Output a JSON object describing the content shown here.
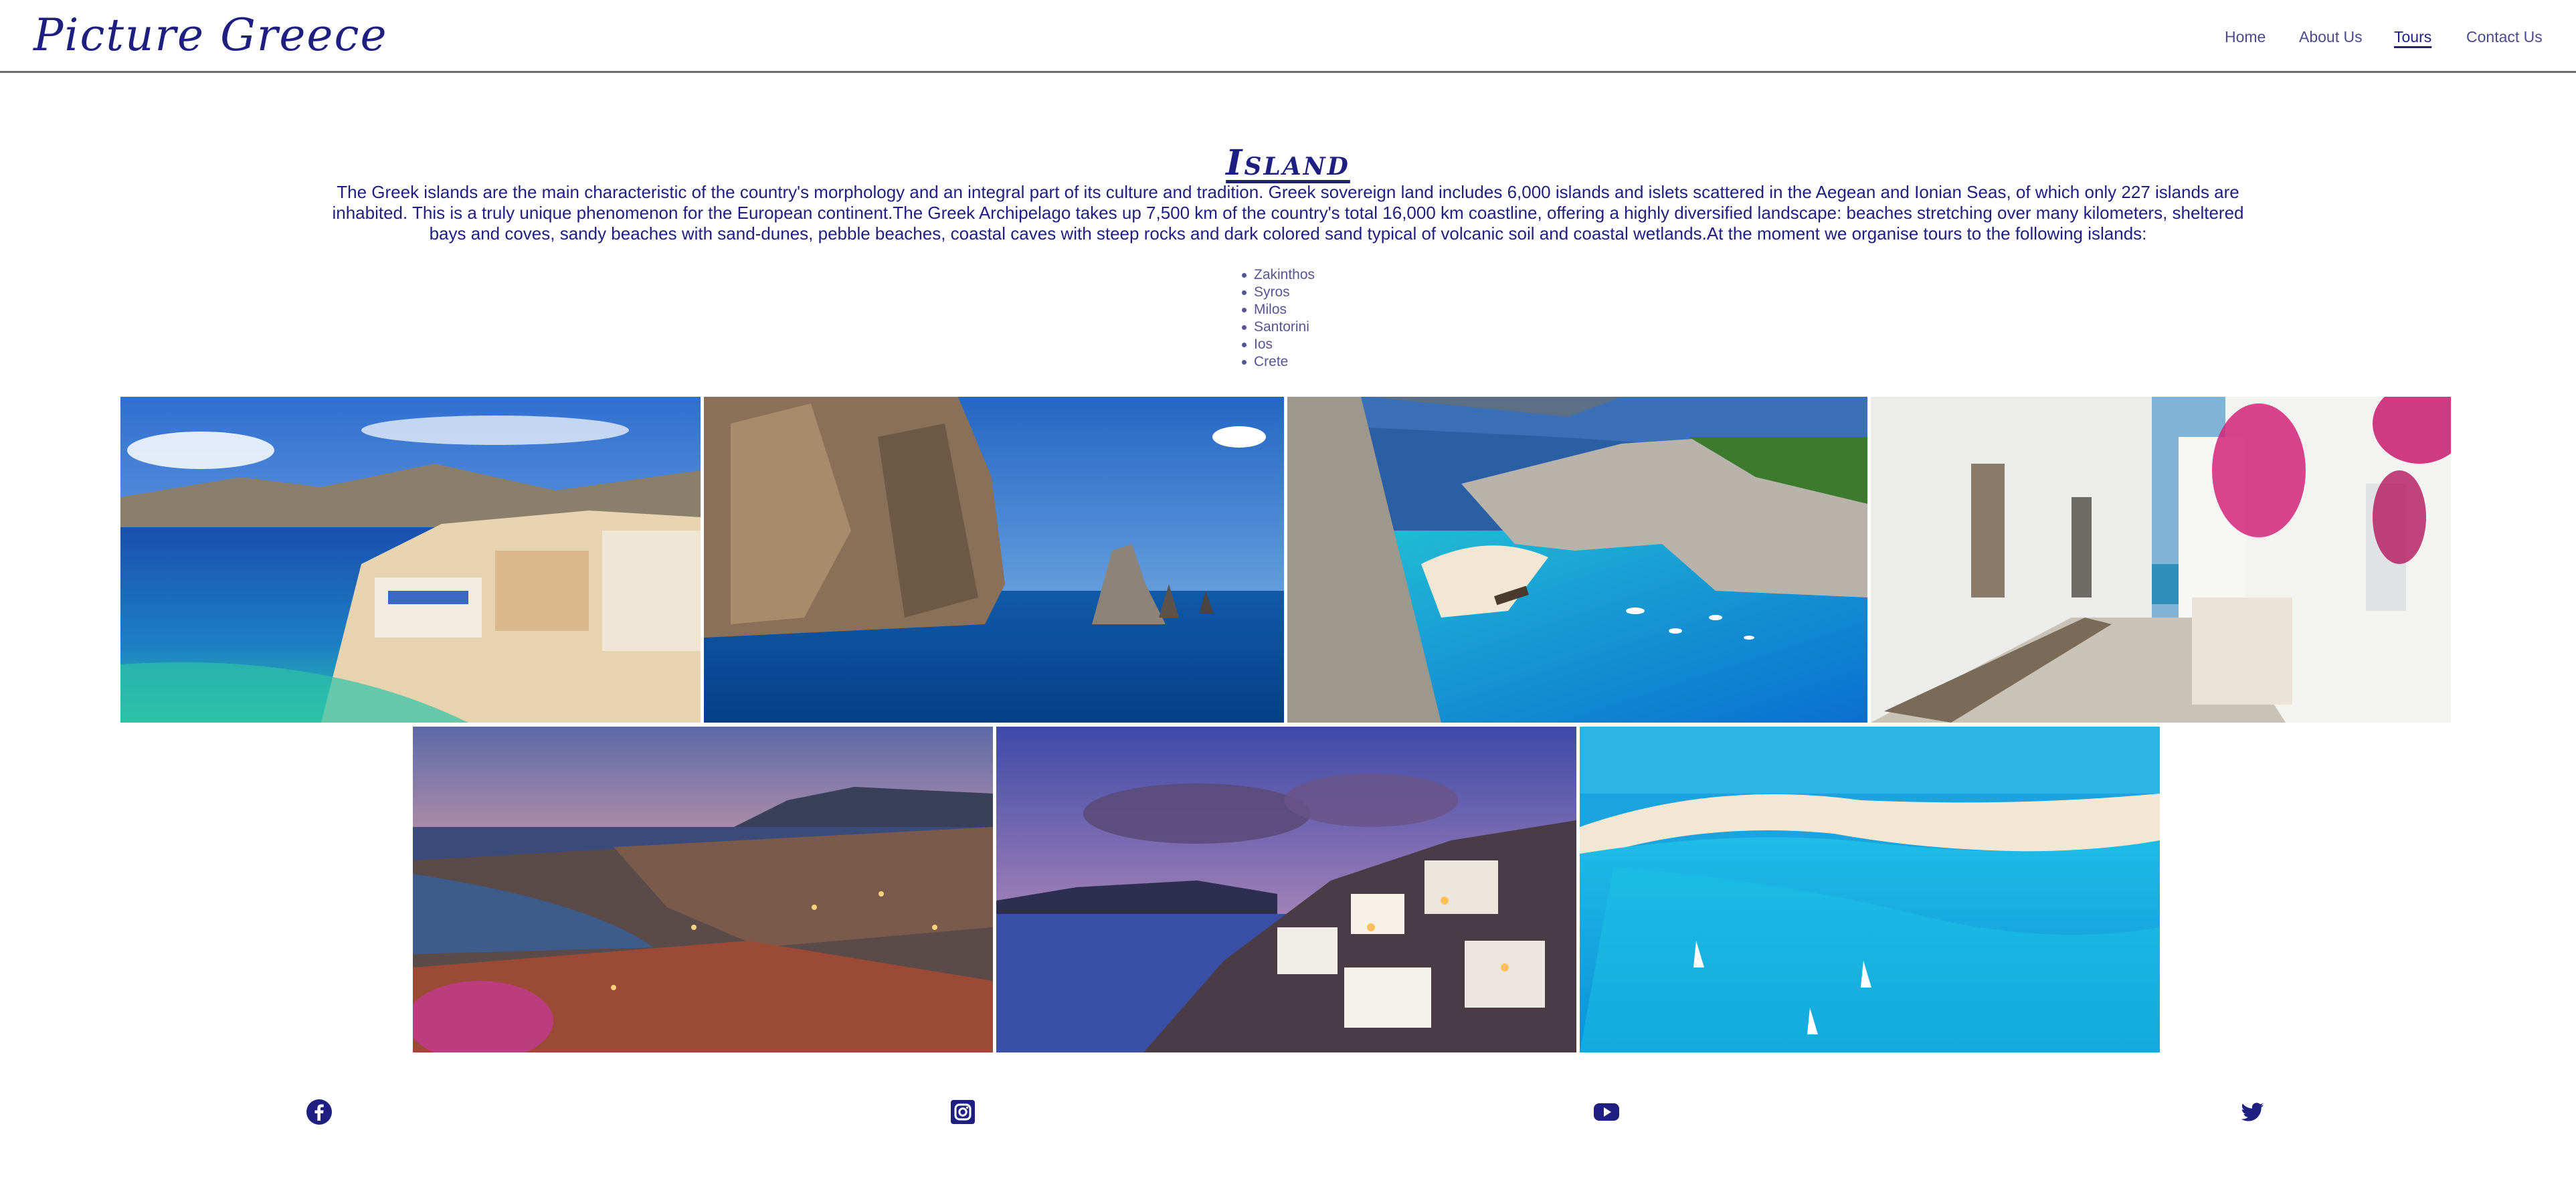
{
  "header": {
    "logo": "Picture Greece",
    "nav": [
      "Home",
      "About Us",
      "Tours",
      "Contact Us"
    ],
    "active_nav": "Tours"
  },
  "main": {
    "title": "Island",
    "intro": "The Greek islands are the main characteristic of the country's morphology and an integral part of its culture and tradition. Greek sovereign land includes 6,000 islands and islets scattered in the Aegean and Ionian Seas, of which only 227 islands are inhabited. This is a truly unique phenomenon for the European continent.The Greek Archipelago takes up 7,500 km of the country's total 16,000 km coastline, offering a highly diversified landscape: beaches stretching over many kilometers, sheltered bays and coves, sandy beaches with sand-dunes, pebble beaches, coastal caves with steep rocks and dark colored sand typical of volcanic soil and coastal wetlands.At the moment we organise tours to the following islands:",
    "islands": [
      "Zakinthos",
      "Syros",
      "Milos",
      "Santorini",
      "Ios",
      "Crete"
    ]
  },
  "footer": {
    "social_icons": [
      "facebook-icon",
      "instagram-icon",
      "youtube-icon",
      "twitter-icon"
    ]
  },
  "colors": {
    "brand": "#1f1f82",
    "nav_text": "#4a4a8c",
    "header_border": "#6e6e6e"
  }
}
